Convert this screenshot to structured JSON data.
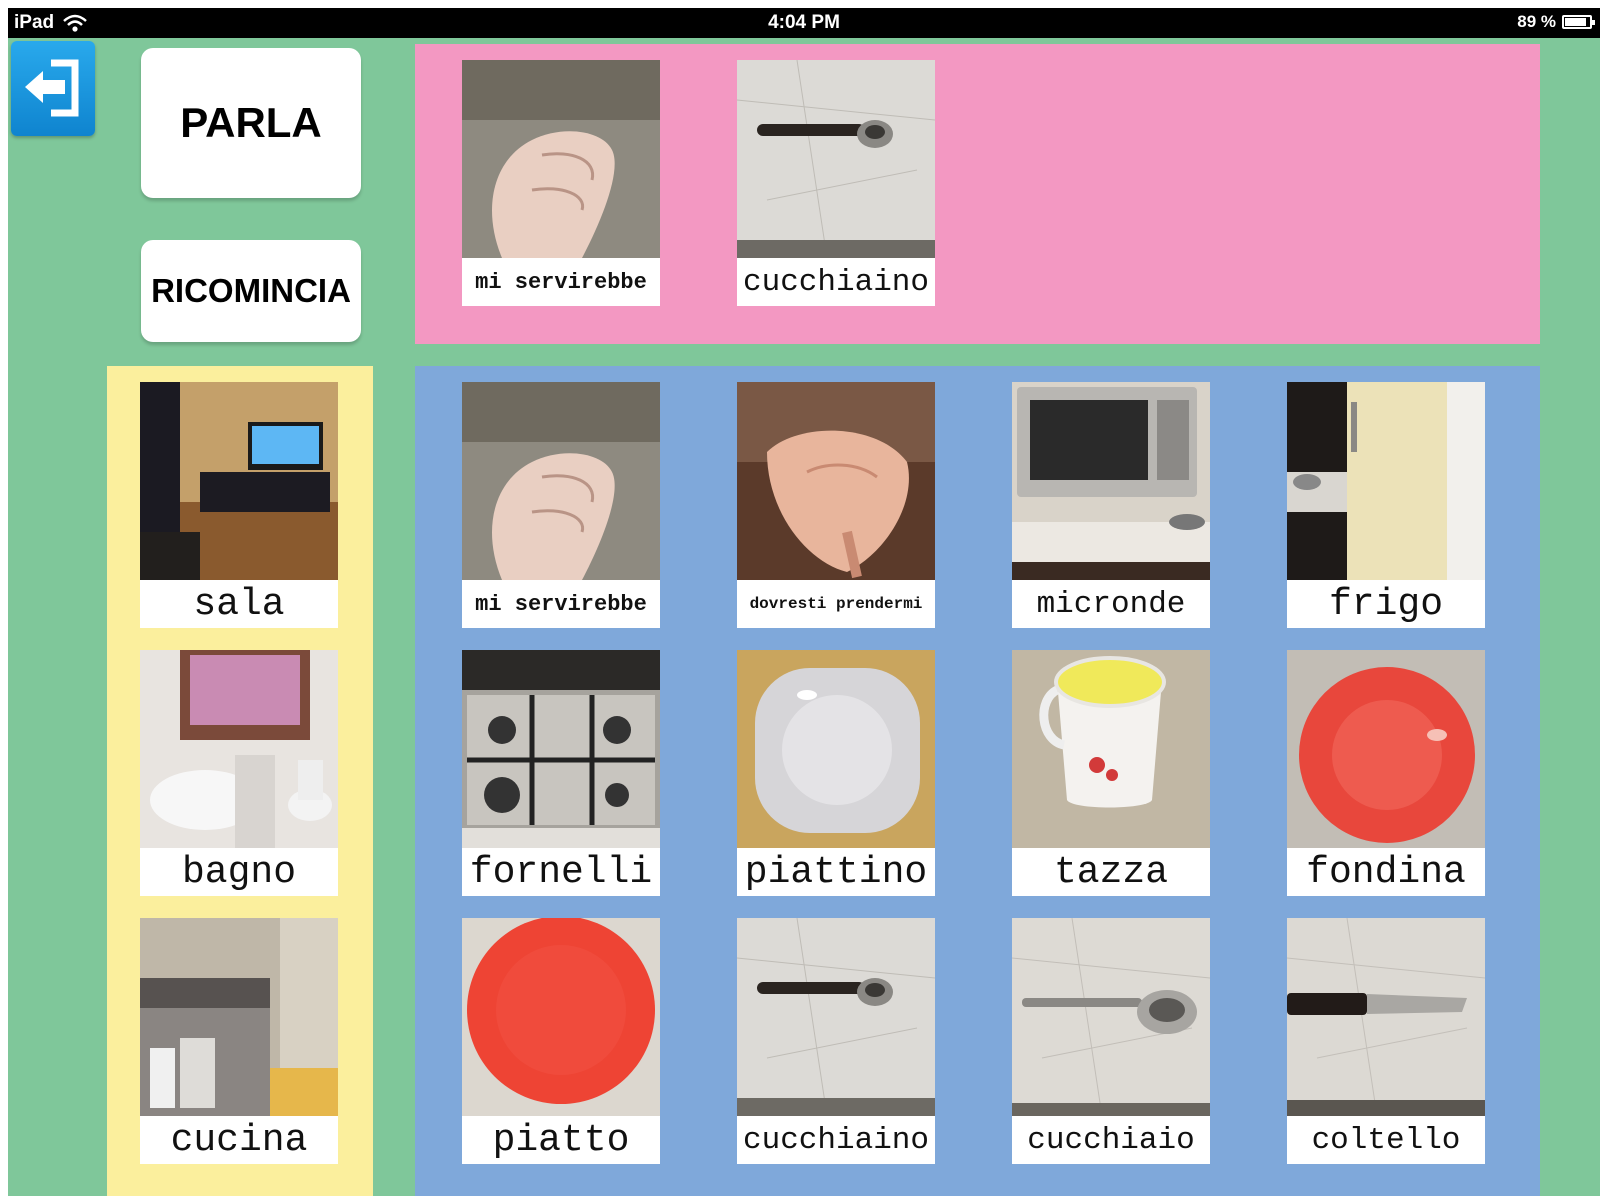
{
  "status_bar": {
    "device": "iPad",
    "time": "4:04 PM",
    "battery": "89 %",
    "battery_level": 0.89
  },
  "toolbar": {
    "back_icon": "exit-arrow-icon",
    "speak_label": "PARLA",
    "restart_label": "RICOMINCIA"
  },
  "sentence": [
    {
      "label": "mi servirebbe",
      "image": "hand-gesture-photo"
    },
    {
      "label": "cucchiaino",
      "image": "teaspoon-photo"
    }
  ],
  "categories": [
    {
      "label": "sala",
      "image": "living-room-photo"
    },
    {
      "label": "bagno",
      "image": "bathroom-photo"
    },
    {
      "label": "cucina",
      "image": "kitchen-photo"
    }
  ],
  "board": [
    {
      "label": "mi servirebbe",
      "image": "hand-gesture-photo"
    },
    {
      "label": "dovresti prendermi",
      "image": "pointing-hand-photo"
    },
    {
      "label": "micronde",
      "image": "microwave-photo"
    },
    {
      "label": "frigo",
      "image": "fridge-photo"
    },
    {
      "label": "fornelli",
      "image": "stove-photo"
    },
    {
      "label": "piattino",
      "image": "white-plate-photo"
    },
    {
      "label": "tazza",
      "image": "mug-photo"
    },
    {
      "label": "fondina",
      "image": "red-bowl-photo"
    },
    {
      "label": "piatto",
      "image": "red-plate-photo"
    },
    {
      "label": "cucchiaino",
      "image": "teaspoon-photo"
    },
    {
      "label": "cucchiaio",
      "image": "spoon-photo"
    },
    {
      "label": "coltello",
      "image": "knife-photo"
    }
  ],
  "colors": {
    "background": "#7fc79a",
    "sentence_bar": "#f398c2",
    "category_panel": "#fbef9d",
    "board_panel": "#7fa8da",
    "back_button": "#1b96de"
  }
}
